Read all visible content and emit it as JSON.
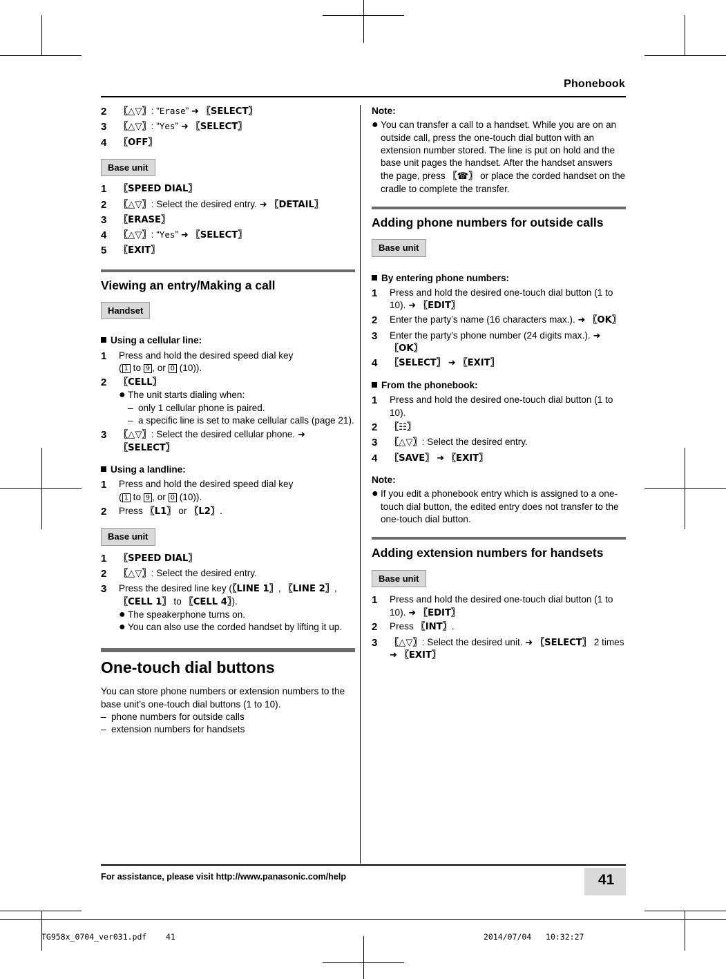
{
  "header": {
    "title": "Phonebook"
  },
  "footer": {
    "assistance": "For assistance, please visit http://www.panasonic.com/help",
    "page_number": "41",
    "strip_file": "TG958x_0704_ver031.pdf",
    "strip_page": "41",
    "strip_date": "2014/07/04",
    "strip_time": "10:32:27"
  },
  "left": {
    "erase_steps": [
      {
        "num": "2",
        "text_pre": "",
        "key1": "{↕}",
        "text_mid": ": “",
        "quoted": "Erase",
        "text_mid2": "” ",
        "arrow": "→",
        "key2": "{SELECT}"
      },
      {
        "num": "3",
        "key1": "{↕}",
        "quoted": "Yes",
        "key2": "{SELECT}"
      },
      {
        "num": "4",
        "key1": "{OFF}"
      }
    ],
    "baseunit_label_1": "Base unit",
    "base_steps_1": [
      {
        "num": "1",
        "key": "{SPEED DIAL}"
      },
      {
        "num": "2",
        "key": "{↕}",
        "text": ": Select the desired entry.",
        "arrow": "→",
        "key2": "{DETAIL}"
      },
      {
        "num": "3",
        "key": "{ERASE}"
      },
      {
        "num": "4",
        "key": "{↕}",
        "text": ": “",
        "quoted": "Yes",
        "text2": "” ",
        "arrow": "→",
        "key2": "{SELECT}"
      },
      {
        "num": "5",
        "key": "{EXIT}"
      }
    ],
    "section_viewing": "Viewing an entry/Making a call",
    "handset_label": "Handset",
    "cellular_head": "Using a cellular line:",
    "cellular_steps": [
      {
        "num": "1",
        "line1": "Press and hold the desired speed dial key",
        "line2_pre": "(",
        "k1": "1",
        "mid": " to ",
        "k2": "9",
        "mid2": ", or ",
        "k3": "0",
        "post": " (10))."
      },
      {
        "num": "2",
        "key": "{CELL}",
        "bullets": [
          "The unit starts dialing when:"
        ],
        "dashes": [
          "only 1 cellular phone is paired.",
          "a specific line is set to make cellular calls (page 21)."
        ]
      },
      {
        "num": "3",
        "key": "{↕}",
        "text": ": Select the desired cellular phone. ",
        "arrow": "→",
        "key2": "{SELECT}"
      }
    ],
    "landline_head": "Using a landline:",
    "landline_steps": [
      {
        "num": "1",
        "line1": "Press and hold the desired speed dial key",
        "line2_pre": "(",
        "k1": "1",
        "mid": " to ",
        "k2": "9",
        "mid2": ", or ",
        "k3": "0",
        "post": " (10))."
      },
      {
        "num": "2",
        "pre": "Press ",
        "key1": "{L1}",
        "mid": " or ",
        "key2": "{L2}",
        "post": "."
      }
    ],
    "baseunit_label_2": "Base unit",
    "base_steps_2": [
      {
        "num": "1",
        "key": "{SPEED DIAL}"
      },
      {
        "num": "2",
        "key": "{↕}",
        "text": ": Select the desired entry."
      },
      {
        "num": "3",
        "pre": "Press the desired line key (",
        "k1": "{LINE 1}",
        "c1": ", ",
        "k2": "{LINE 2}",
        "c2": ", ",
        "k3": "{CELL 1}",
        "mid": " to ",
        "k4": "{CELL 4}",
        "post": ").",
        "bullets": [
          "The speakerphone turns on.",
          "You can also use the corded handset by lifting it up."
        ]
      }
    ],
    "section_onetouch": "One-touch dial buttons",
    "onetouch_para": "You can store phone numbers or extension numbers to the base unit’s one-touch dial buttons (1 to 10).",
    "onetouch_dashes": [
      "phone numbers for outside calls",
      "extension numbers for handsets"
    ]
  },
  "right": {
    "note_title_1": "Note:",
    "note_1": "You can transfer a call to a handset. While you are on an outside call, press the one-touch dial button with an extension number stored. The line is put on hold and the base unit pages the handset. After the handset answers the page, press ",
    "note_1_key": "{☎}",
    "note_1_cont": " or place the corded handset on the cradle to complete the transfer.",
    "section_adding_outside": "Adding phone numbers for outside calls",
    "baseunit_label_1": "Base unit",
    "by_entering_head": "By entering phone numbers:",
    "by_entering_steps": [
      {
        "num": "1",
        "text": "Press and hold the desired one-touch dial button (1 to 10). ",
        "arrow": "→",
        "key": "{EDIT}"
      },
      {
        "num": "2",
        "text": "Enter the party’s name (16 characters max.). ",
        "arrow": "→",
        "key": "{OK}"
      },
      {
        "num": "3",
        "text": "Enter the party’s phone number (24 digits max.). ",
        "arrow": "→",
        "key": "{OK}"
      },
      {
        "num": "4",
        "key": "{SELECT}",
        "arrow": "→",
        "key2": "{EXIT}"
      }
    ],
    "from_phonebook_head": "From the phonebook:",
    "from_phonebook_steps": [
      {
        "num": "1",
        "text": "Press and hold the desired one-touch dial button (1 to 10)."
      },
      {
        "num": "2",
        "key": "{⎙}"
      },
      {
        "num": "3",
        "key": "{↕}",
        "text": ": Select the desired entry."
      },
      {
        "num": "4",
        "key": "{SAVE}",
        "arrow": "→",
        "key2": "{EXIT}"
      }
    ],
    "note_title_2": "Note:",
    "note_2": "If you edit a phonebook entry which is assigned to a one-touch dial button, the edited entry does not transfer to the one-touch dial button.",
    "section_adding_ext": "Adding extension numbers for handsets",
    "baseunit_label_2": "Base unit",
    "ext_steps": [
      {
        "num": "1",
        "text": "Press and hold the desired one-touch dial button (1 to 10). ",
        "arrow": "→",
        "key": "{EDIT}"
      },
      {
        "num": "2",
        "pre": "Press ",
        "key": "{INT}",
        "post": "."
      },
      {
        "num": "3",
        "key": "{↕}",
        "text": ": Select the desired unit. ",
        "arrow": "→",
        "key2": "{SELECT}",
        "mid": " 2 times ",
        "arrow2": "→",
        "key3": "{EXIT}"
      }
    ]
  }
}
